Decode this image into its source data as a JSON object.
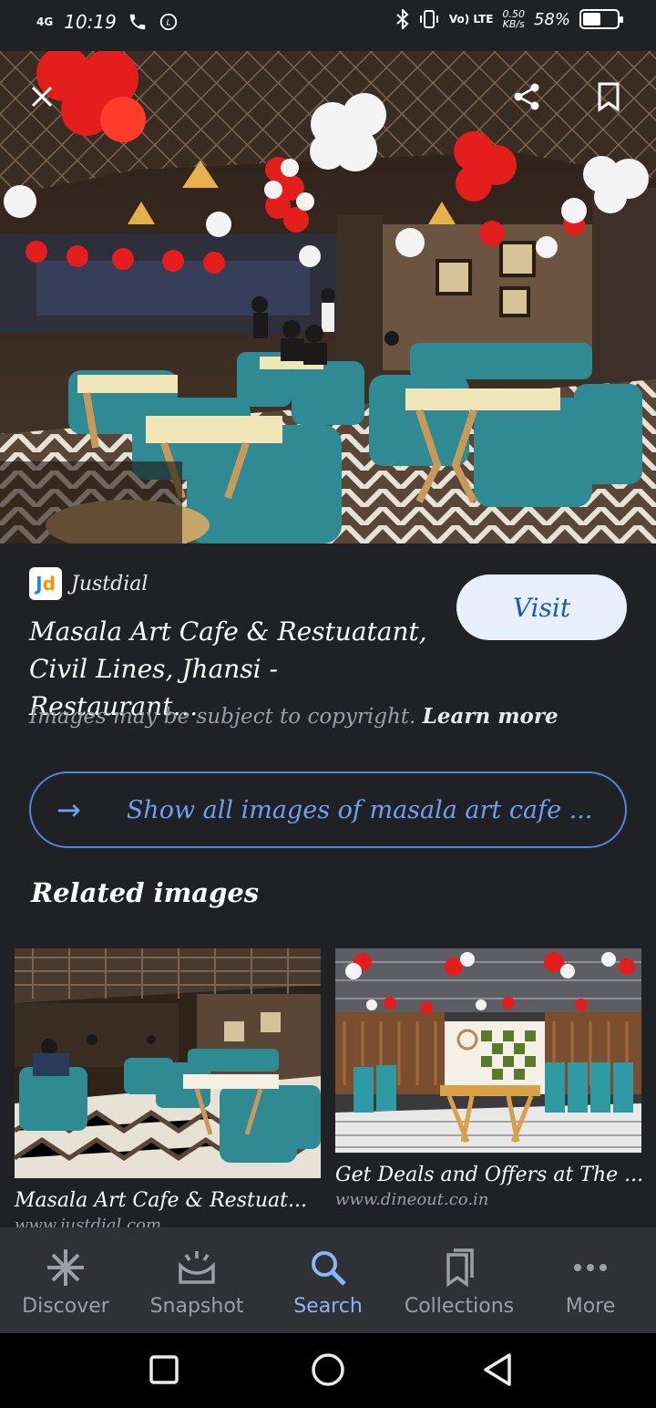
{
  "status_bar": {
    "network": "4G",
    "time": "10:19",
    "net_speed_value": "0.50",
    "net_speed_unit": "KB/s",
    "volte": "Vo) LTE",
    "battery": "58%",
    "battery_level": 0.58
  },
  "hero": {
    "close_icon": "close-icon",
    "share_icon": "share-icon",
    "bookmark_icon": "bookmark-icon"
  },
  "result": {
    "source_logo": "Jd",
    "source_name": "Justdial",
    "title": "Masala Art Cafe & Restuatant, Civil Lines, Jhansi - Restaurant…",
    "visit_label": "Visit",
    "copyright_text": "Images may be subject to copyright.",
    "learn_more": "Learn more",
    "show_all_label": "Show all images of masala art cafe ..."
  },
  "related": {
    "heading": "Related images",
    "items": [
      {
        "title": "Masala Art Cafe & Restuat...",
        "source": "www.justdial.com"
      },
      {
        "title": "Get Deals and Offers at The ...",
        "source": "www.dineout.co.in"
      }
    ]
  },
  "bottom_nav": {
    "items": [
      {
        "label": "Discover",
        "icon": "asterisk-icon"
      },
      {
        "label": "Snapshot",
        "icon": "snapshot-icon"
      },
      {
        "label": "Search",
        "icon": "search-icon"
      },
      {
        "label": "Collections",
        "icon": "collections-icon"
      },
      {
        "label": "More",
        "icon": "more-dots-icon"
      }
    ],
    "active": "Search"
  },
  "colors": {
    "background": "#202124",
    "accent": "#8ab4f8",
    "visit_button_bg": "#e8f0fe",
    "nav_bg": "#303134"
  }
}
